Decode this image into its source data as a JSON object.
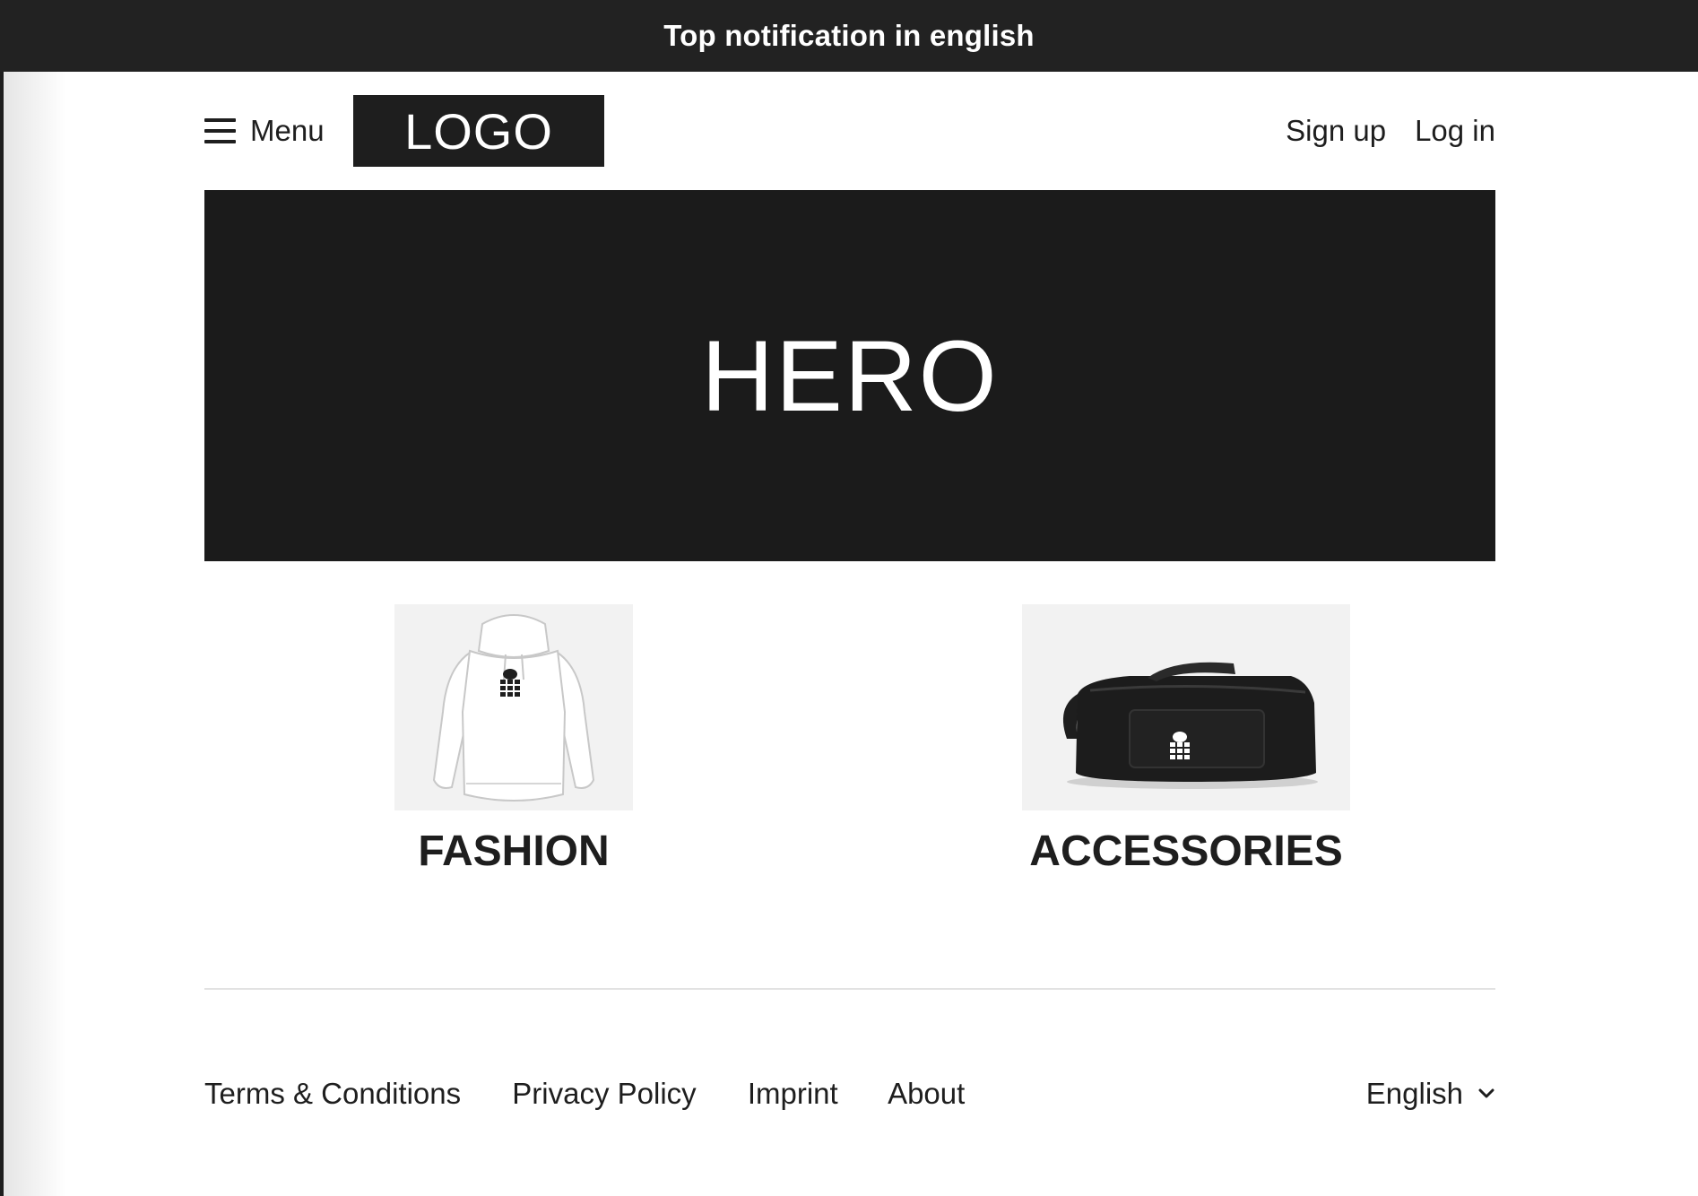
{
  "notification": {
    "text": "Top notification in english"
  },
  "header": {
    "menu_label": "Menu",
    "logo_text": "LOGO",
    "signup_label": "Sign up",
    "login_label": "Log in"
  },
  "hero": {
    "text": "HERO"
  },
  "categories": [
    {
      "label": "FASHION",
      "image": "white-hoodie"
    },
    {
      "label": "ACCESSORIES",
      "image": "black-duffel-bag"
    }
  ],
  "footer": {
    "links": [
      "Terms & Conditions",
      "Privacy Policy",
      "Imprint",
      "About"
    ],
    "language": "English"
  },
  "icons": {
    "menu": "hamburger-icon",
    "language": "chevron-down-icon"
  },
  "colors": {
    "notification_bg": "#222222",
    "hero_bg": "#1b1b1b",
    "logo_bg": "#1e1e1e",
    "thumb_bg": "#f2f2f2",
    "text": "#1e1e1e"
  }
}
